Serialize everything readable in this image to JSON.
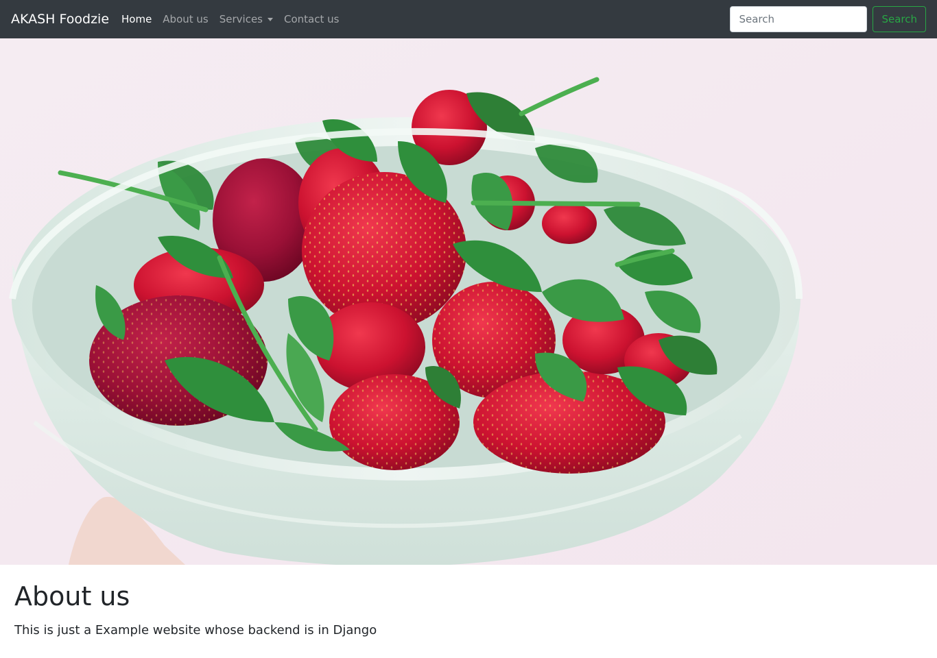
{
  "navbar": {
    "brand": "AKASH Foodzie",
    "links": [
      {
        "label": "Home",
        "active": true
      },
      {
        "label": "About us",
        "active": false
      },
      {
        "label": "Services",
        "active": false,
        "dropdown": true
      },
      {
        "label": "Contact us",
        "active": false
      }
    ],
    "search": {
      "placeholder": "Search",
      "value": "",
      "button_label": "Search"
    }
  },
  "hero": {
    "image_subject": "bowl-of-strawberries-photo"
  },
  "about": {
    "title": "About us",
    "text": "This is just a Example website whose backend is in Django"
  },
  "colors": {
    "navbar_bg": "#343a40",
    "brand_text": "#ffffff",
    "nav_link_muted": "rgba(255,255,255,0.55)",
    "search_button_accent": "#28a745",
    "body_text": "#212529"
  },
  "icons": {
    "services_dropdown": "caret-down-icon"
  }
}
